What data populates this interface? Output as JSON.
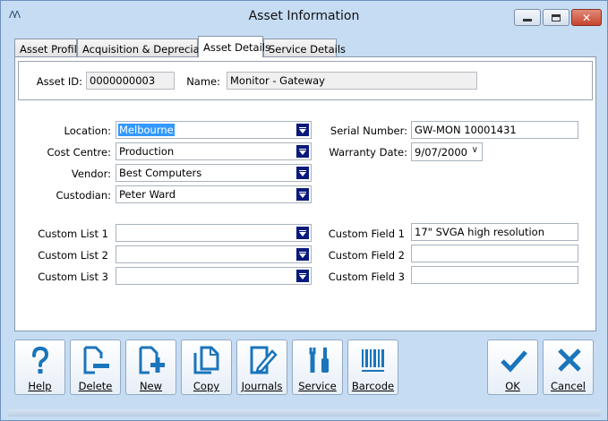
{
  "window": {
    "title": "Asset Information",
    "app_icon_glyph": "ᐱᐱ",
    "close_glyph": "✕"
  },
  "tabs": [
    {
      "label": "Asset Profile"
    },
    {
      "label": "Acquisition & Depreciation"
    },
    {
      "label": "Asset Details",
      "active": true
    },
    {
      "label": "Service Details"
    }
  ],
  "asset": {
    "id_label": "Asset ID:",
    "id_value": "0000000003",
    "name_label": "Name:",
    "name_value": "Monitor - Gateway"
  },
  "details": {
    "location_label": "Location:",
    "location_value": "Melbourne",
    "cost_centre_label": "Cost Centre:",
    "cost_centre_value": "Production",
    "vendor_label": "Vendor:",
    "vendor_value": "Best Computers",
    "custodian_label": "Custodian:",
    "custodian_value": "Peter Ward",
    "serial_label": "Serial Number:",
    "serial_value": "GW-MON 10001431",
    "warranty_label": "Warranty Date:",
    "warranty_value": "9/07/2000"
  },
  "custom": {
    "list1_label": "Custom List 1",
    "list1_value": "",
    "list2_label": "Custom List 2",
    "list2_value": "",
    "list3_label": "Custom List 3",
    "list3_value": "",
    "field1_label": "Custom Field 1",
    "field1_value": "17\" SVGA high resolution",
    "field2_label": "Custom Field 2",
    "field2_value": "",
    "field3_label": "Custom Field 3",
    "field3_value": ""
  },
  "toolbar": {
    "help": "Help",
    "delete": "Delete",
    "new": "New",
    "copy": "Copy",
    "journals": "Journals",
    "service": "Service",
    "barcode": "Barcode",
    "ok": "OK",
    "cancel": "Cancel"
  },
  "colors": {
    "window_bg": "#c5dcf3",
    "icon_blue": "#1a75bb",
    "dropdown_button": "#0a1a7a",
    "selection": "#3399ff"
  }
}
